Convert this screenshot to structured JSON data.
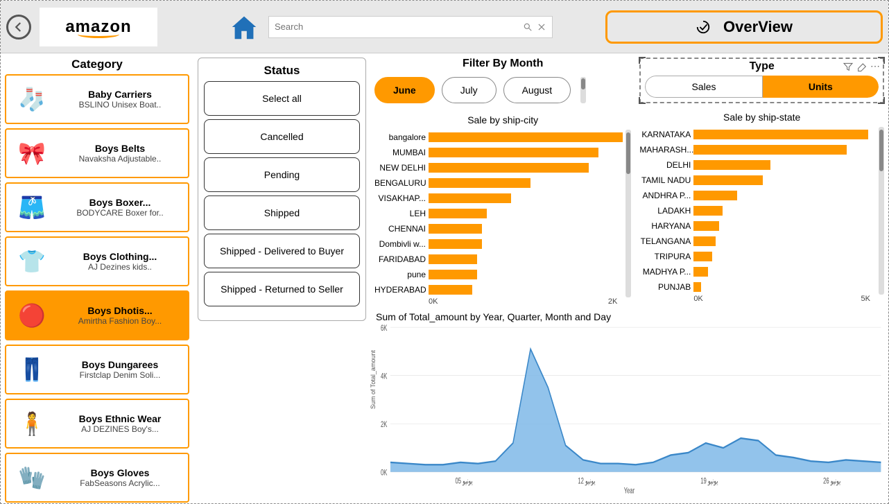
{
  "header": {
    "logo_text": "amazon",
    "search_placeholder": "Search",
    "overview_label": "OverView"
  },
  "category": {
    "title": "Category",
    "items": [
      {
        "name": "Baby Carriers",
        "sub": "BSLINO Unisex Boat..",
        "emoji": "🧦"
      },
      {
        "name": "Boys Belts",
        "sub": "Navaksha Adjustable..",
        "emoji": "🎀"
      },
      {
        "name": "Boys Boxer...",
        "sub": "BODYCARE Boxer for..",
        "emoji": "🩳"
      },
      {
        "name": "Boys Clothing...",
        "sub": "AJ Dezines kids..",
        "emoji": "👕"
      },
      {
        "name": "Boys Dhotis...",
        "sub": "Amirtha Fashion Boy...",
        "emoji": "🔴",
        "active": true
      },
      {
        "name": "Boys Dungarees",
        "sub": "Firstclap Denim Soli...",
        "emoji": "👖"
      },
      {
        "name": "Boys Ethnic Wear",
        "sub": "AJ DEZINES Boy's...",
        "emoji": "🧍"
      },
      {
        "name": "Boys Gloves",
        "sub": "FabSeasons Acrylic...",
        "emoji": "🧤"
      }
    ]
  },
  "status": {
    "title": "Status",
    "options": [
      "Select all",
      "Cancelled",
      "Pending",
      "Shipped",
      "Shipped - Delivered to Buyer",
      "Shipped - Returned to Seller"
    ]
  },
  "month_filter": {
    "title": "Filter By Month",
    "items": [
      {
        "label": "June",
        "active": true
      },
      {
        "label": "July",
        "active": false
      },
      {
        "label": "August",
        "active": false
      }
    ]
  },
  "type_filter": {
    "title": "Type",
    "options": [
      {
        "label": "Sales",
        "active": false
      },
      {
        "label": "Units",
        "active": true
      }
    ]
  },
  "chart_data": [
    {
      "type": "bar",
      "title": "Sale by ship-city",
      "categories": [
        "bangalore",
        "MUMBAI",
        "NEW DELHI",
        "BENGALURU",
        "VISAKHAP...",
        "LEH",
        "CHENNAI",
        "Dombivli w...",
        "FARIDABAD",
        "pune",
        "HYDERABAD"
      ],
      "values": [
        2000,
        1750,
        1650,
        1050,
        850,
        600,
        550,
        550,
        500,
        500,
        450
      ],
      "xlabel": "",
      "ylabel": "",
      "xlim": [
        0,
        2000
      ],
      "ticks": [
        "0K",
        "2K"
      ]
    },
    {
      "type": "bar",
      "title": "Sale by ship-state",
      "categories": [
        "KARNATAKA",
        "MAHARASH...",
        "DELHI",
        "TAMIL NADU",
        "ANDHRA P...",
        "LADAKH",
        "HARYANA",
        "TELANGANA",
        "TRIPURA",
        "MADHYA P...",
        "PUNJAB"
      ],
      "values": [
        4800,
        4200,
        2100,
        1900,
        1200,
        800,
        700,
        600,
        500,
        400,
        200
      ],
      "xlabel": "",
      "ylabel": "",
      "xlim": [
        0,
        5000
      ],
      "ticks": [
        "0K",
        "5K"
      ]
    },
    {
      "type": "area",
      "title": "Sum of Total_amount by Year, Quarter, Month and Day",
      "ylabel": "Sum of Total_amount",
      "xlabel": "Year",
      "yticks": [
        "0K",
        "2K",
        "4K",
        "6K"
      ],
      "xticks": [
        "05 يونيو",
        "12 يونيو",
        "19 يونيو",
        "26 يونيو"
      ],
      "x": [
        1,
        2,
        3,
        4,
        5,
        6,
        7,
        8,
        9,
        10,
        11,
        12,
        13,
        14,
        15,
        16,
        17,
        18,
        19,
        20,
        21,
        22,
        23,
        24,
        25,
        26,
        27,
        28,
        29
      ],
      "values": [
        400,
        350,
        300,
        300,
        400,
        350,
        450,
        1200,
        5100,
        3500,
        1100,
        500,
        350,
        350,
        300,
        400,
        700,
        800,
        1200,
        1000,
        1400,
        1300,
        700,
        600,
        450,
        400,
        500,
        450,
        400
      ],
      "ylim": [
        0,
        6000
      ]
    }
  ]
}
